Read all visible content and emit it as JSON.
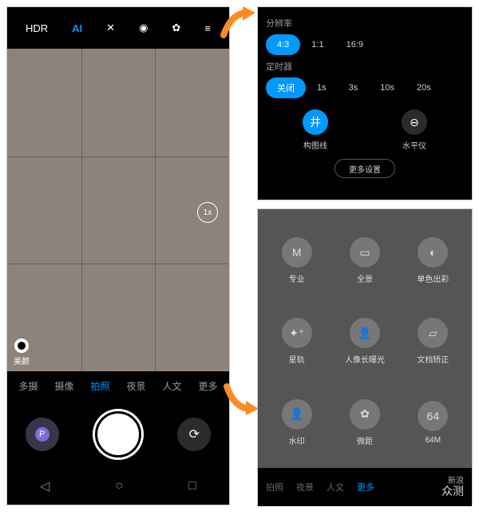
{
  "panel1": {
    "topbar": {
      "hdr": "HDR",
      "ai": "AI"
    },
    "zoom": "1x",
    "beauty": "美颜",
    "modes": {
      "m1": "多摄",
      "m2": "摄像",
      "m3": "拍照",
      "m4": "夜景",
      "m5": "人文",
      "m6": "更多"
    },
    "thumb_letter": "P"
  },
  "panel2": {
    "resolution_label": "分辨率",
    "res": {
      "r1": "4:3",
      "r2": "1:1",
      "r3": "16:9"
    },
    "timer_label": "定时器",
    "timer": {
      "t1": "关闭",
      "t2": "1s",
      "t3": "3s",
      "t4": "10s",
      "t5": "20s"
    },
    "tools": {
      "grid": "构图线",
      "level": "水平仪"
    },
    "more": "更多设置"
  },
  "panel3": {
    "items": {
      "pro": "专业",
      "pano": "全景",
      "mono": "单色出彩",
      "star": "星轨",
      "portrait": "人像长曝光",
      "doc": "文档矫正",
      "watermark": "水印",
      "macro": "微距",
      "m64": "64M"
    },
    "m64_icon": "64",
    "bar": {
      "b1": "拍照",
      "b2": "夜景",
      "b3": "人文",
      "b4": "更多"
    },
    "logo": {
      "line1": "新浪",
      "line2": "众测"
    }
  }
}
